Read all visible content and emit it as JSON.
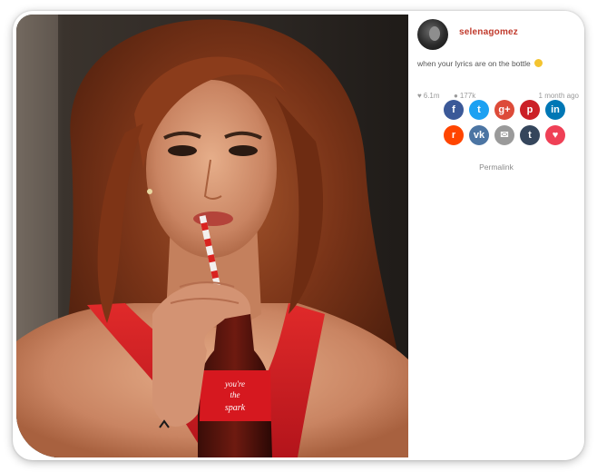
{
  "post": {
    "username": "selenagomez",
    "caption": "when your lyrics are on the bottle",
    "caption_emoji": "face-with-open-mouth-emoji",
    "likes": "6.1m",
    "comments": "177k",
    "time": "1 month ago",
    "permalink": "Permalink",
    "bottle_label": "you're the spark"
  },
  "share_buttons": [
    {
      "name": "facebook",
      "glyph": "f",
      "color": "#3b5998"
    },
    {
      "name": "twitter",
      "glyph": "t",
      "color": "#1da1f2"
    },
    {
      "name": "google-plus",
      "glyph": "g+",
      "color": "#dd4b39"
    },
    {
      "name": "pinterest",
      "glyph": "p",
      "color": "#cb2027"
    },
    {
      "name": "linkedin",
      "glyph": "in",
      "color": "#0077b5"
    },
    {
      "name": "reddit",
      "glyph": "r",
      "color": "#ff4500"
    },
    {
      "name": "vk",
      "glyph": "vk",
      "color": "#4c75a3"
    },
    {
      "name": "email",
      "glyph": "✉",
      "color": "#9a9a9a"
    },
    {
      "name": "tumblr",
      "glyph": "t",
      "color": "#35465c"
    },
    {
      "name": "pocket",
      "glyph": "♥",
      "color": "#ef4056"
    }
  ],
  "icons": {
    "likes": "heart-icon",
    "comments": "speech-bubble-icon"
  }
}
